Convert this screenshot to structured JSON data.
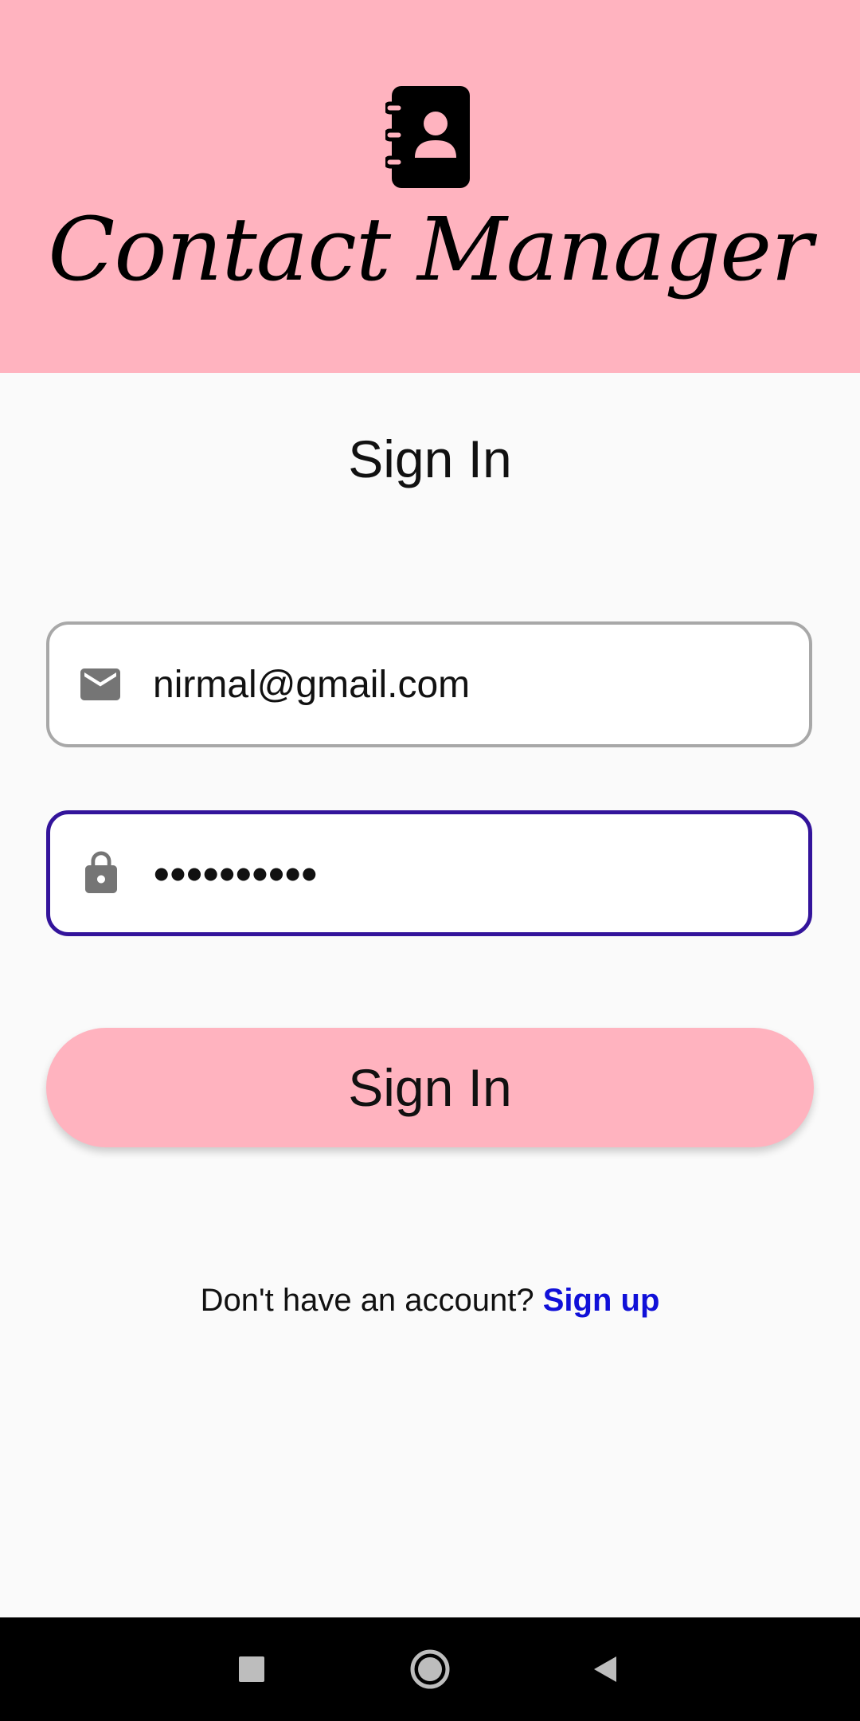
{
  "app": {
    "title": "Contact Manager",
    "icon": "contact-book-icon",
    "header_color": "#ffb3bf"
  },
  "page": {
    "title": "Sign In"
  },
  "email_field": {
    "value": "nirmal@gmail.com",
    "icon": "mail-icon"
  },
  "password_field": {
    "value": "••••••••••",
    "icon": "lock-icon",
    "focus_color": "#33149b"
  },
  "signin_button": {
    "label": "Sign In"
  },
  "signup": {
    "prompt": "Don't have an account? ",
    "link_label": "Sign up",
    "link_color": "#1010d8"
  },
  "navbar": {
    "items": [
      "recents-icon",
      "home-icon",
      "back-icon"
    ]
  }
}
